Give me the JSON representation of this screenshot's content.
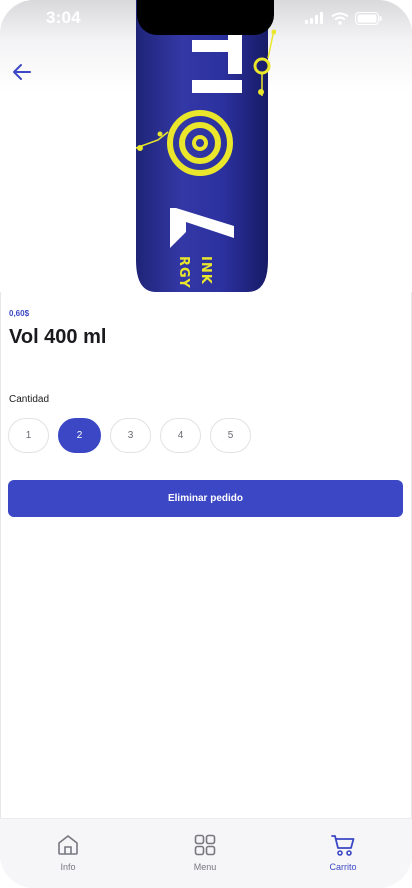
{
  "status_bar": {
    "time": "3:04"
  },
  "product": {
    "price": "0,60$",
    "name": "Vol 400 ml",
    "brand_text": "VOLT",
    "tagline": "ENERGY DRINK"
  },
  "quantity": {
    "label": "Cantidad",
    "options": [
      "1",
      "2",
      "3",
      "4",
      "5"
    ],
    "selected": "2"
  },
  "primary_action": {
    "label": "Eliminar pedido"
  },
  "tabbar": {
    "tabs": [
      {
        "label": "Info",
        "icon": "home-icon"
      },
      {
        "label": "Menu",
        "icon": "grid-icon"
      },
      {
        "label": "Carrito",
        "icon": "cart-icon"
      }
    ],
    "active": "Carrito"
  },
  "colors": {
    "accent": "#3b47c4",
    "bottle": "#2a2f8e",
    "logo_yellow": "#e9e62b"
  }
}
